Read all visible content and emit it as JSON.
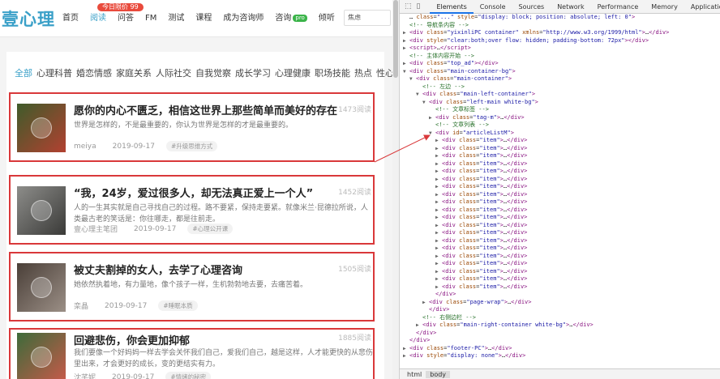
{
  "site": {
    "logo": "壹心理",
    "promo": "今日限价 99",
    "nav": [
      {
        "label": "首页",
        "active": false
      },
      {
        "label": "阅读",
        "active": true
      },
      {
        "label": "问答",
        "active": false
      },
      {
        "label": "FM",
        "active": false
      },
      {
        "label": "测试",
        "active": false
      },
      {
        "label": "课程",
        "active": false
      },
      {
        "label": "成为咨询师",
        "active": false
      },
      {
        "label": "咨询",
        "active": false,
        "badge": "pro"
      },
      {
        "label": "倾听",
        "active": false
      }
    ],
    "nav_more": "•••",
    "search_placeholder": "焦虑",
    "tags": [
      "全部",
      "心理科普",
      "婚恋情感",
      "家庭关系",
      "人际社交",
      "自我觉察",
      "成长学习",
      "心理健康",
      "职场技能",
      "热点",
      "性心理"
    ],
    "articles": [
      {
        "title": "愿你的内心不匮乏，相信这世界上那些简单而美好的存在",
        "views": "1473阅读",
        "desc": "世界是怎样的，不是最重要的，你认为世界是怎样的才是最重要的。",
        "author": "meiya",
        "date": "2019-09-17",
        "chip": "#升级思维方式"
      },
      {
        "title": "“我，24岁，爱过很多人，却无法真正爱上一个人”",
        "views": "1452阅读",
        "desc": "人的一生其实就是自己寻找自己的过程。路不要紧，保持走要紧。就像米兰·昆德拉所说，人类最古老的笑话是：你往哪走，都是往前走。",
        "author": "壹心理主笔团",
        "date": "2019-09-17",
        "chip": "#心理公开课"
      },
      {
        "title": "被丈夫割掉的女人，去学了心理咨询",
        "views": "1505阅读",
        "desc": "她依然执着地，有力量地，像个孩子一样，生机勃勃地去要，去痛苦着。",
        "author": "栾晶",
        "date": "2019-09-17",
        "chip": "#睡眠本质"
      },
      {
        "title": "回避悲伤，你会更加抑郁",
        "views": "1885阅读",
        "desc": "我们要像一个好妈妈一样去学会关怀我们自己，爱我们自己，越是这样，人才能更快的从悲伤里出来，才会更好的成长，变的更结实有力。",
        "author": "沈芊妮",
        "date": "2019-09-17",
        "chip": "#情绪的秘密"
      }
    ]
  },
  "devtools": {
    "tabs": [
      {
        "label": "Elements",
        "active": true
      },
      {
        "label": "Console",
        "active": false
      },
      {
        "label": "Sources",
        "active": false
      },
      {
        "label": "Network",
        "active": false
      },
      {
        "label": "Performance",
        "active": false
      },
      {
        "label": "Memory",
        "active": false
      },
      {
        "label": "Application",
        "active": false
      }
    ],
    "more": "»",
    "header_lines": [
      {
        "indent": 0,
        "html": "<span class='t-txt'>…</span> <span class='t-attr'>class</span>=<span class='t-val'>\"...\"</span> <span class='t-attr'>style</span>=<span class='t-val'>\"display: block; position: absolute; left: 0\"</span><span class='t-tag'>&gt;</span>"
      },
      {
        "indent": 0,
        "html": "<span class='t-com'>&lt;!-- 导航条内容 --&gt;</span>"
      },
      {
        "indent": 0,
        "tri": "▶",
        "html": "<span class='t-tag'>&lt;div</span> <span class='t-attr'>class</span>=<span class='t-val'>\"yixinliPC container\"</span> <span class='t-attr'>xmlns</span>=<span class='t-val'>\"http://www.w3.org/1999/html\"</span><span class='t-tag'>&gt;</span>…<span class='t-tag'>&lt;/div&gt;</span>"
      },
      {
        "indent": 0,
        "tri": "▶",
        "html": "<span class='t-tag'>&lt;div</span> <span class='t-attr'>style</span>=<span class='t-val'>\"clear:both;over flow: hidden; padding-bottom: 72px\"</span><span class='t-tag'>&gt;&lt;/div&gt;</span>"
      },
      {
        "indent": 0,
        "tri": "▶",
        "html": "<span class='t-tag'>&lt;script&gt;</span>…<span class='t-tag'>&lt;/script&gt;</span>"
      },
      {
        "indent": 0,
        "html": "<span class='t-com'>&lt;!-- 主体内容开始 --&gt;</span>"
      },
      {
        "indent": 0,
        "tri": "▶",
        "html": "<span class='t-tag'>&lt;div</span> <span class='t-attr'>class</span>=<span class='t-val'>\"top_ad\"</span><span class='t-tag'>&gt;&lt;/div&gt;</span>"
      },
      {
        "indent": 0,
        "tri": "▼",
        "html": "<span class='t-tag'>&lt;div</span> <span class='t-attr'>class</span>=<span class='t-val'>\"main-container-bg\"</span><span class='t-tag'>&gt;</span>"
      },
      {
        "indent": 1,
        "tri": "▼",
        "html": "<span class='t-tag'>&lt;div</span> <span class='t-attr'>class</span>=<span class='t-val'>\"main-container\"</span><span class='t-tag'>&gt;</span>"
      },
      {
        "indent": 2,
        "html": "<span class='t-com'>&lt;!-- 左边 --&gt;</span>"
      },
      {
        "indent": 2,
        "tri": "▼",
        "html": "<span class='t-tag'>&lt;div</span> <span class='t-attr'>class</span>=<span class='t-val'>\"main-left-container\"</span><span class='t-tag'>&gt;</span>"
      },
      {
        "indent": 3,
        "tri": "▼",
        "html": "<span class='t-tag'>&lt;div</span> <span class='t-attr'>class</span>=<span class='t-val'>\"left-main white-bg\"</span><span class='t-tag'>&gt;</span>"
      },
      {
        "indent": 4,
        "html": "<span class='t-com'>&lt;!-- 文章标签 --&gt;</span>"
      },
      {
        "indent": 4,
        "tri": "▶",
        "html": "<span class='t-tag'>&lt;div</span> <span class='t-attr'>class</span>=<span class='t-val'>\"tag-m\"</span><span class='t-tag'>&gt;</span>…<span class='t-tag'>&lt;/div&gt;</span>"
      },
      {
        "indent": 4,
        "html": "<span class='t-com'>&lt;!-- 文章列表 --&gt;</span>"
      },
      {
        "indent": 4,
        "tri": "▼",
        "html": "<span class='t-tag'>&lt;div</span> <span class='t-attr'>id</span>=<span class='t-val'>\"articleListM\"</span><span class='t-tag'>&gt;</span>"
      }
    ],
    "item_line": "<span class='t-tag'>&lt;div</span> <span class='t-attr'>class</span>=<span class='t-val'>\"item\"</span><span class='t-tag'>&gt;</span>…<span class='t-tag'>&lt;/div&gt;</span>",
    "item_count": 20,
    "footer_lines": [
      {
        "indent": 4,
        "html": "<span class='t-tag'>&lt;/div&gt;</span>"
      },
      {
        "indent": 3,
        "tri": "▶",
        "html": "<span class='t-tag'>&lt;div</span> <span class='t-attr'>class</span>=<span class='t-val'>\"page-wrap\"</span><span class='t-tag'>&gt;</span>…<span class='t-tag'>&lt;/div&gt;</span>"
      },
      {
        "indent": 3,
        "html": "<span class='t-tag'>&lt;/div&gt;</span>"
      },
      {
        "indent": 2,
        "html": "<span class='t-com'>&lt;!-- 右侧边栏 --&gt;</span>"
      },
      {
        "indent": 2,
        "tri": "▶",
        "html": "<span class='t-tag'>&lt;div</span> <span class='t-attr'>class</span>=<span class='t-val'>\"main-right-container white-bg\"</span><span class='t-tag'>&gt;</span>…<span class='t-tag'>&lt;/div&gt;</span>"
      },
      {
        "indent": 1,
        "html": "<span class='t-tag'>&lt;/div&gt;</span>"
      },
      {
        "indent": 0,
        "html": "<span class='t-tag'>&lt;/div&gt;</span>"
      },
      {
        "indent": 0,
        "tri": "▶",
        "html": "<span class='t-tag'>&lt;div</span> <span class='t-attr'>class</span>=<span class='t-val'>\"footer-PC\"</span><span class='t-tag'>&gt;</span>…<span class='t-tag'>&lt;/div&gt;</span>"
      },
      {
        "indent": 0,
        "tri": "▶",
        "html": "<span class='t-tag'>&lt;div</span> <span class='t-attr'>style</span>=<span class='t-val'>\"display: none\"</span><span class='t-tag'>&gt;</span>…<span class='t-tag'>&lt;/div&gt;</span>"
      }
    ],
    "breadcrumbs": [
      {
        "label": "html",
        "active": false
      },
      {
        "label": "body",
        "active": true
      }
    ]
  },
  "colors": {
    "accent": "#3aa0c8",
    "highlight_border": "#d9383a",
    "promo": "#e94a3c",
    "pro_badge": "#3bb44a"
  }
}
